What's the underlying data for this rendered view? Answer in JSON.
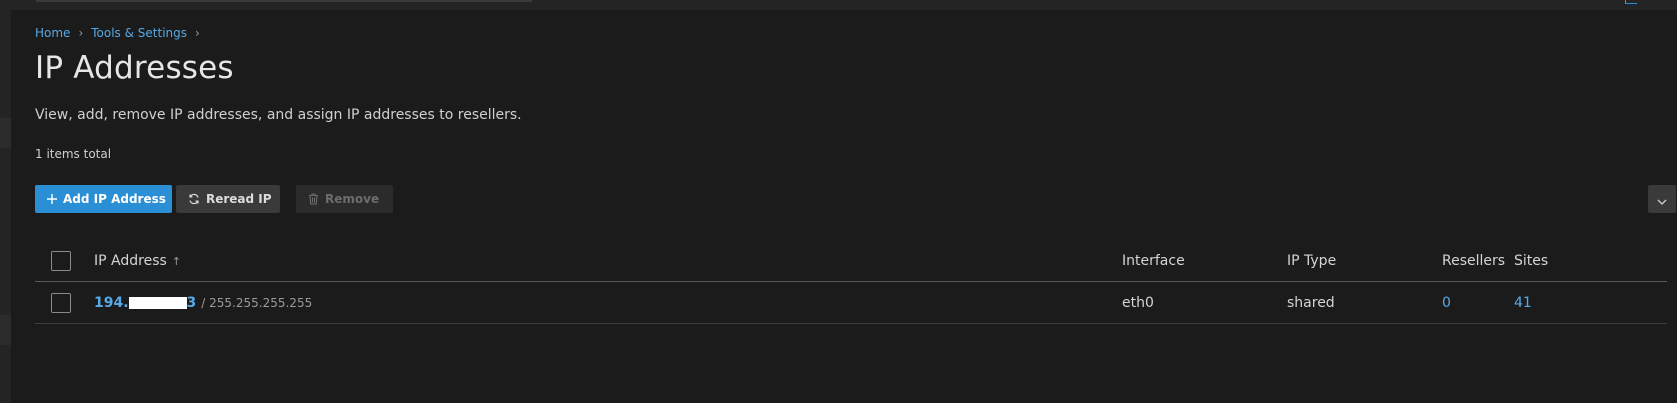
{
  "breadcrumb": {
    "items": [
      "Home",
      "Tools & Settings"
    ],
    "separator": "›"
  },
  "page": {
    "title": "IP Addresses",
    "description": "View, add, remove IP addresses, and assign IP addresses to resellers.",
    "total": "1 items total"
  },
  "toolbar": {
    "add_label": "Add IP Address",
    "add_icon": "plus-icon",
    "reread_label": "Reread IP",
    "reread_icon": "refresh-icon",
    "remove_label": "Remove",
    "remove_icon": "trash-icon",
    "expand_icon": "chevron-down-icon"
  },
  "table": {
    "columns": {
      "ip": "IP Address",
      "interface": "Interface",
      "type": "IP Type",
      "resellers": "Resellers",
      "sites": "Sites"
    },
    "sort_indicator": "↑",
    "rows": [
      {
        "ip_prefix": "194.",
        "ip_suffix": "3",
        "mask": "/ 255.255.255.255",
        "interface": "eth0",
        "type": "shared",
        "resellers": "0",
        "sites": "41"
      }
    ]
  },
  "colors": {
    "accent": "#2b8fd6",
    "link": "#57a9e6",
    "background": "#1b1b1b"
  }
}
